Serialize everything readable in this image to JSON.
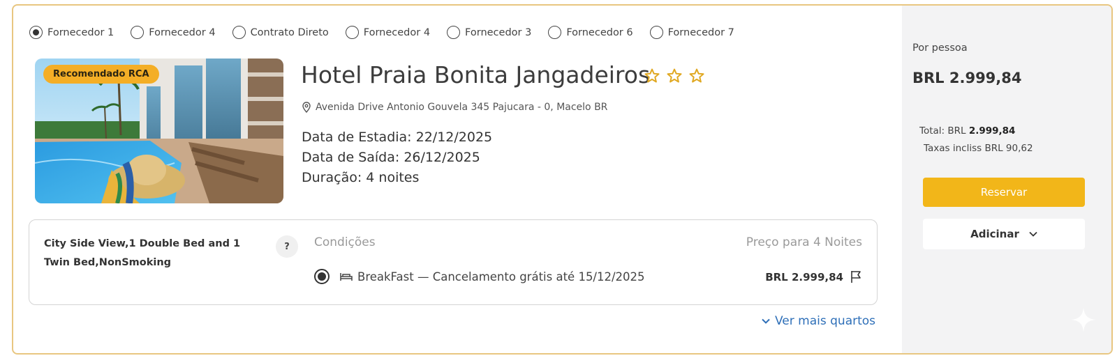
{
  "suppliers": [
    {
      "label": "Fornecedor 1",
      "selected": true
    },
    {
      "label": "Fornecedor 4",
      "selected": false
    },
    {
      "label": "Contrato Direto",
      "selected": false
    },
    {
      "label": "Fornecedor 4",
      "selected": false
    },
    {
      "label": "Fornecedor 3",
      "selected": false
    },
    {
      "label": "Fornecedor 6",
      "selected": false
    },
    {
      "label": "Fornecedor 7",
      "selected": false
    }
  ],
  "hotel": {
    "badge": "Recomendado RCA",
    "name": "Hotel Praia Bonita Jangadeiros",
    "stars": 3,
    "address": "Avenida Drive Antonio Gouvela 345 Pajucara - 0, Macelo BR",
    "checkin": "Data de Estadia: 22/12/2025",
    "checkout": "Data de Saída: 26/12/2025",
    "duration": "Duração: 4 noites"
  },
  "room": {
    "name": "City Side View,1 Double Bed and 1 Twin Bed,NonSmoking",
    "help_label": "?",
    "conditions_header": "Condições",
    "price_header": "Preço para 4 Noites",
    "rate_text": "BreakFast — Cancelamento grátis até 15/12/2025",
    "rate_price": "BRL 2.999,84",
    "more_rooms": "Ver mais quartos"
  },
  "summary": {
    "per_person_label": "Por pessoa",
    "price": "BRL 2.999,84",
    "total_label": "Total: BRL ",
    "total_value": "2.999,84",
    "taxes": "Taxas incliss BRL 90,62",
    "reserve_label": "Reservar",
    "add_label": "Adicinar"
  },
  "colors": {
    "accent": "#f2b619",
    "badge": "#f4ae26",
    "link": "#2e6fb8",
    "card_border": "#e8c680",
    "panel_bg": "#f3f3f4"
  },
  "icons": [
    "star-icon",
    "location-pin-icon",
    "bed-icon",
    "flag-icon",
    "chevron-down-icon",
    "sparkle-icon"
  ]
}
